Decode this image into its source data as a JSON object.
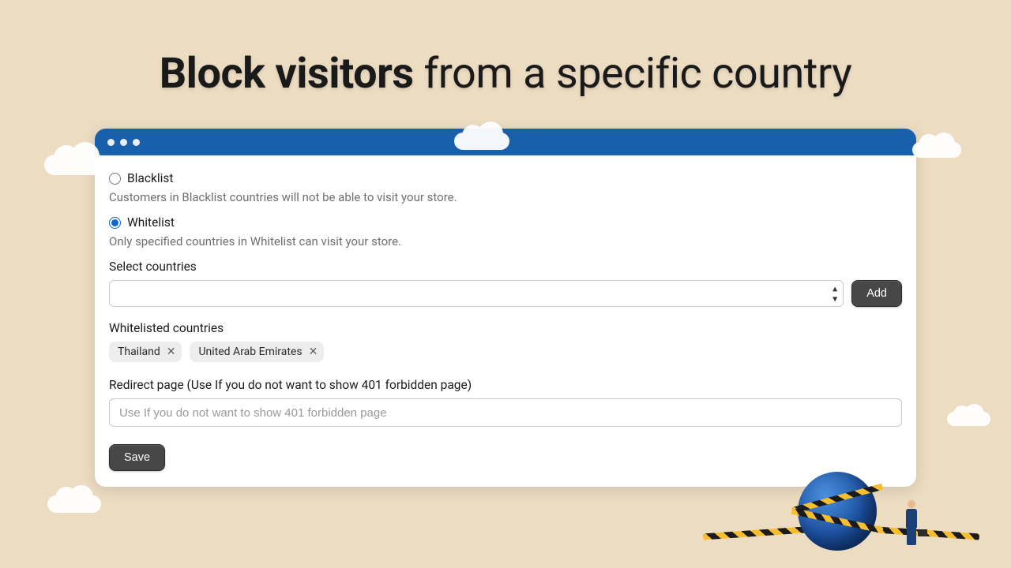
{
  "headline": {
    "bold": "Block visitors",
    "rest": " from a specific country"
  },
  "options": {
    "blacklist": {
      "label": "Blacklist",
      "desc": "Customers in Blacklist countries will not be able to visit your store.",
      "checked": false
    },
    "whitelist": {
      "label": "Whitelist",
      "desc": "Only specified countries in Whitelist can visit your store.",
      "checked": true
    }
  },
  "select": {
    "label": "Select countries",
    "add_button": "Add"
  },
  "whitelisted": {
    "label": "Whitelisted countries",
    "tags": [
      "Thailand",
      "United Arab Emirates"
    ]
  },
  "redirect": {
    "label": "Redirect page (Use If you do not want to show 401 forbidden page)",
    "placeholder": "Use If you do not want to show 401 forbidden page",
    "value": ""
  },
  "save_button": "Save"
}
